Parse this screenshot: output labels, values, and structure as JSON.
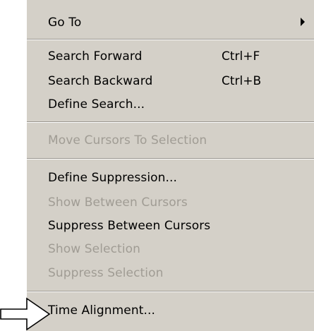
{
  "menu": {
    "items": [
      {
        "label": "Go To",
        "shortcut": "",
        "enabled": true,
        "submenu": true
      },
      {
        "label": "Search Forward",
        "shortcut": "Ctrl+F",
        "enabled": true
      },
      {
        "label": "Search Backward",
        "shortcut": "Ctrl+B",
        "enabled": true
      },
      {
        "label": "Define Search...",
        "shortcut": "",
        "enabled": true
      },
      {
        "label": "Move Cursors To Selection",
        "shortcut": "",
        "enabled": false
      },
      {
        "label": "Define Suppression...",
        "shortcut": "",
        "enabled": true
      },
      {
        "label": "Show Between Cursors",
        "shortcut": "",
        "enabled": false
      },
      {
        "label": "Suppress Between Cursors",
        "shortcut": "",
        "enabled": true
      },
      {
        "label": "Show Selection",
        "shortcut": "",
        "enabled": false
      },
      {
        "label": "Suppress Selection",
        "shortcut": "",
        "enabled": false
      },
      {
        "label": "Time Alignment...",
        "shortcut": "",
        "enabled": true
      }
    ]
  },
  "colors": {
    "menu_background": "#d4d0c8",
    "disabled_text": "#a09c94",
    "separator_dark": "#9a968f"
  },
  "icons": {
    "submenu": "triangle-right-icon",
    "pointer": "outline-arrow-icon"
  }
}
